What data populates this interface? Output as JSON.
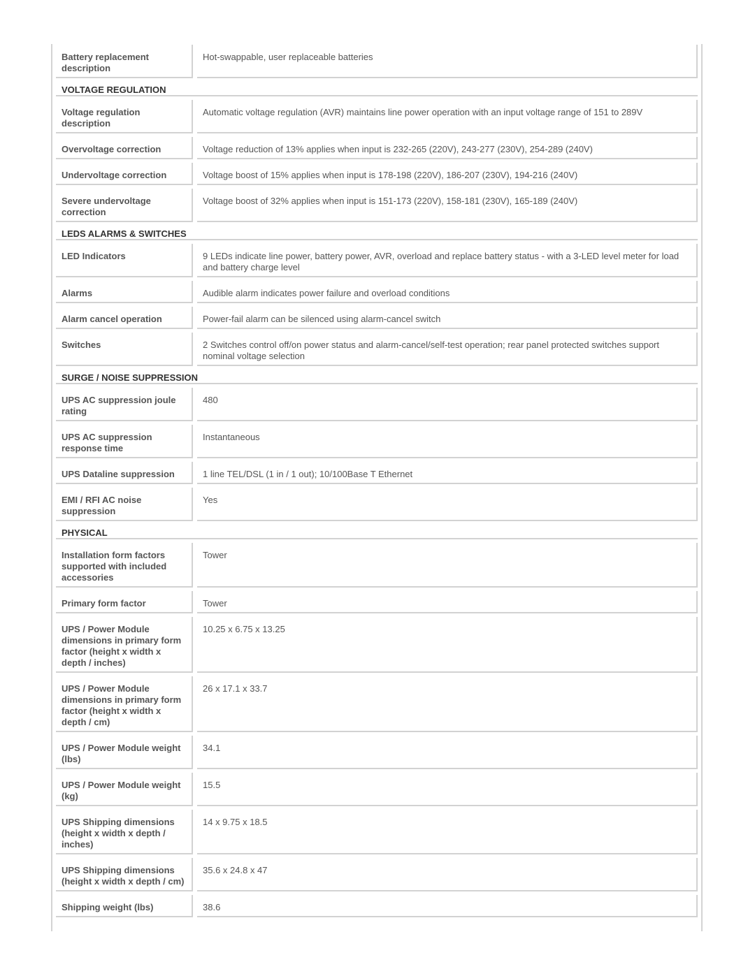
{
  "sections": [
    {
      "title": "",
      "rows": [
        {
          "label": "Battery replacement description",
          "value": "Hot-swappable, user replaceable batteries"
        }
      ]
    },
    {
      "title": "VOLTAGE REGULATION",
      "rows": [
        {
          "label": "Voltage regulation description",
          "value": "Automatic voltage regulation (AVR) maintains line power operation with an input voltage range of 151 to 289V"
        },
        {
          "label": "Overvoltage correction",
          "value": "Voltage reduction of 13% applies when input is 232-265 (220V), 243-277 (230V), 254-289 (240V)"
        },
        {
          "label": "Undervoltage correction",
          "value": "Voltage boost of 15% applies when input is 178-198 (220V), 186-207 (230V), 194-216 (240V)"
        },
        {
          "label": "Severe undervoltage correction",
          "value": "Voltage boost of 32% applies when input is 151-173 (220V), 158-181 (230V), 165-189 (240V)"
        }
      ]
    },
    {
      "title": "LEDS ALARMS & SWITCHES",
      "rows": [
        {
          "label": "LED Indicators",
          "value": "9 LEDs indicate line power, battery power, AVR, overload and replace battery status - with a 3-LED level meter for load and battery charge level"
        },
        {
          "label": "Alarms",
          "value": "Audible alarm indicates power failure and overload conditions"
        },
        {
          "label": "Alarm cancel operation",
          "value": "Power-fail alarm can be silenced using alarm-cancel switch"
        },
        {
          "label": "Switches",
          "value": "2 Switches control off/on power status and alarm-cancel/self-test operation; rear panel protected switches support nominal voltage selection"
        }
      ]
    },
    {
      "title": "SURGE / NOISE SUPPRESSION",
      "rows": [
        {
          "label": "UPS AC suppression joule rating",
          "value": "480"
        },
        {
          "label": "UPS AC suppression response time",
          "value": "Instantaneous"
        },
        {
          "label": "UPS Dataline suppression",
          "value": "1 line TEL/DSL (1 in / 1 out); 10/100Base T Ethernet"
        },
        {
          "label": "EMI / RFI AC noise suppression",
          "value": "Yes"
        }
      ]
    },
    {
      "title": "PHYSICAL",
      "rows": [
        {
          "label": "Installation form factors supported with included accessories",
          "value": "Tower"
        },
        {
          "label": "Primary form factor",
          "value": "Tower"
        },
        {
          "label": "UPS / Power Module dimensions in primary form factor (height x width x depth / inches)",
          "value": "10.25 x 6.75 x 13.25"
        },
        {
          "label": "UPS / Power Module dimensions in primary form factor (height x width x depth / cm)",
          "value": "26 x 17.1 x 33.7"
        },
        {
          "label": "UPS / Power Module weight (lbs)",
          "value": "34.1"
        },
        {
          "label": "UPS / Power Module weight (kg)",
          "value": "15.5"
        },
        {
          "label": "UPS Shipping dimensions (height x width x depth / inches)",
          "value": "14 x 9.75 x 18.5"
        },
        {
          "label": "UPS Shipping dimensions (height x width x depth / cm)",
          "value": "35.6 x 24.8 x 47"
        },
        {
          "label": "Shipping weight (lbs)",
          "value": "38.6"
        }
      ]
    }
  ]
}
